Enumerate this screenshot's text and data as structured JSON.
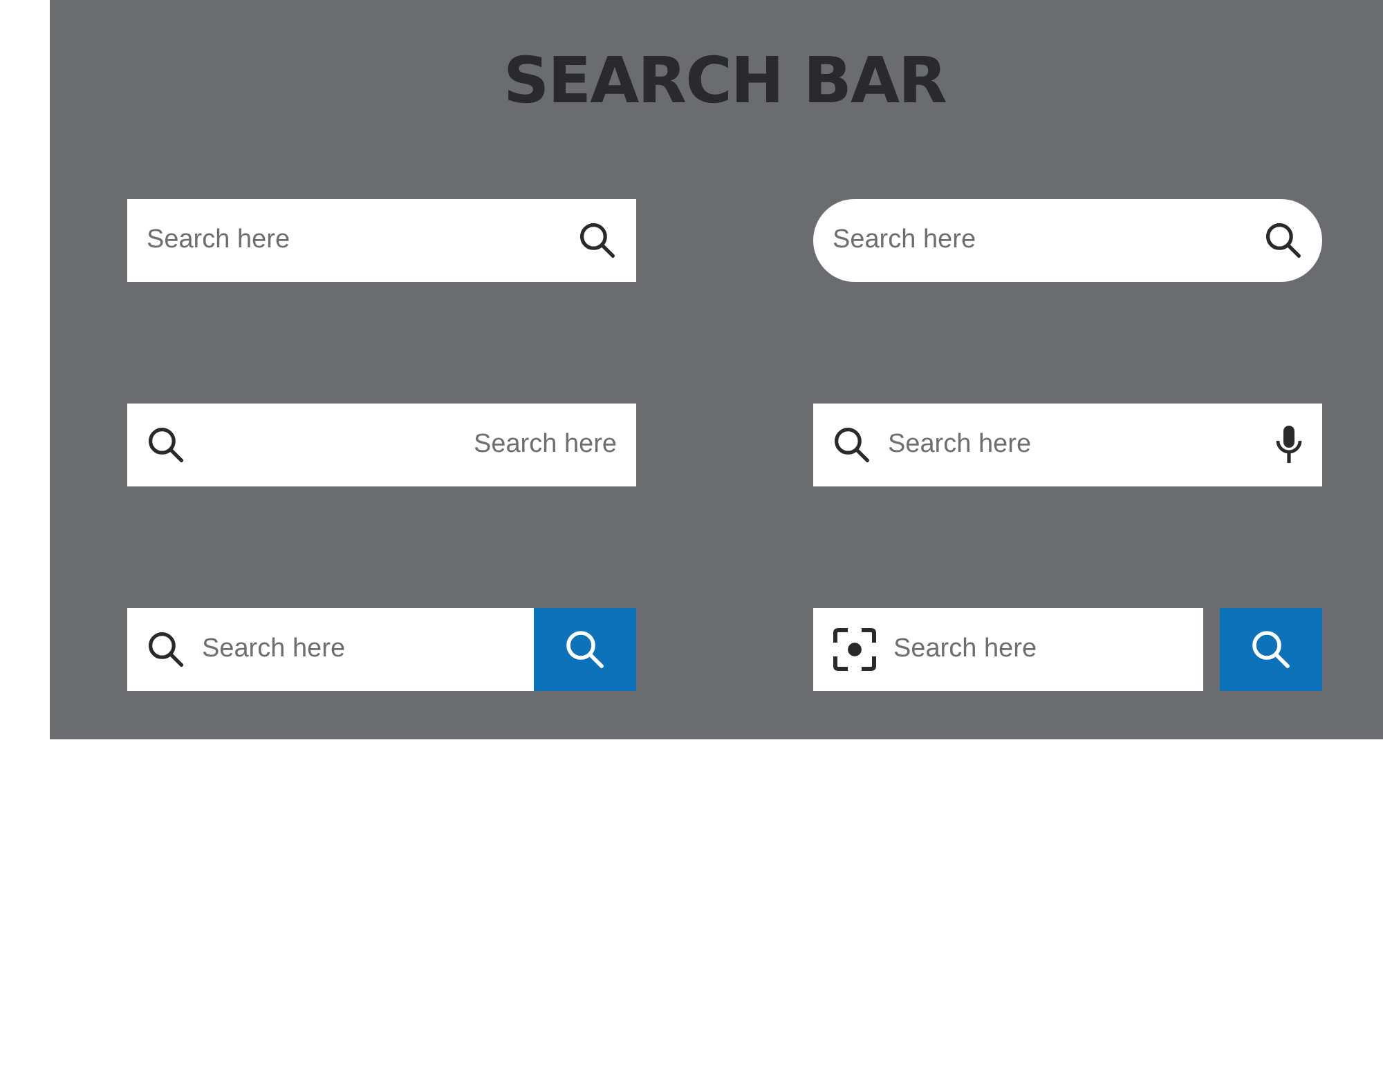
{
  "title": "SEARCH BAR",
  "bars": [
    {
      "kind": "plain",
      "placeholder": "Search here"
    },
    {
      "kind": "pill",
      "placeholder": "Search here"
    },
    {
      "kind": "reversed",
      "placeholder": "Search here"
    },
    {
      "kind": "voice",
      "placeholder": "Search here"
    },
    {
      "kind": "attached-button",
      "placeholder": "Search here"
    },
    {
      "kind": "scan-button",
      "placeholder": "Search here"
    }
  ]
}
